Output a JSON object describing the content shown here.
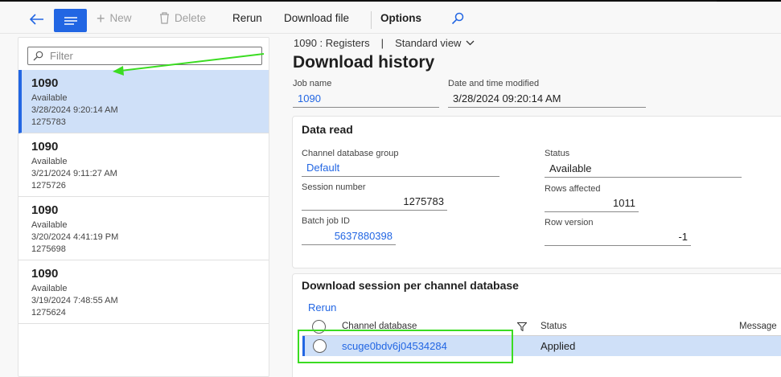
{
  "toolbar": {
    "new_label": "New",
    "delete_label": "Delete",
    "rerun_label": "Rerun",
    "download_file_label": "Download file",
    "options_label": "Options"
  },
  "left": {
    "filter_placeholder": "Filter",
    "items": [
      {
        "title": "1090",
        "status": "Available",
        "datetime": "3/28/2024 9:20:14 AM",
        "session": "1275783"
      },
      {
        "title": "1090",
        "status": "Available",
        "datetime": "3/21/2024 9:11:27 AM",
        "session": "1275726"
      },
      {
        "title": "1090",
        "status": "Available",
        "datetime": "3/20/2024 4:41:19 PM",
        "session": "1275698"
      },
      {
        "title": "1090",
        "status": "Available",
        "datetime": "3/19/2024 7:48:55 AM",
        "session": "1275624"
      }
    ]
  },
  "header": {
    "breadcrumb": "1090 : Registers",
    "separator": "|",
    "view": "Standard view",
    "title": "Download history",
    "job_name_label": "Job name",
    "job_name": "1090",
    "modified_label": "Date and time modified",
    "modified": "3/28/2024 09:20:14 AM"
  },
  "data_read": {
    "title": "Data read",
    "channel_group_label": "Channel database group",
    "channel_group": "Default",
    "session_label": "Session number",
    "session": "1275783",
    "batch_label": "Batch job ID",
    "batch": "5637880398",
    "status_label": "Status",
    "status": "Available",
    "rows_label": "Rows affected",
    "rows": "1011",
    "rowver_label": "Row version",
    "rowver": "-1"
  },
  "sessions": {
    "title": "Download session per channel database",
    "rerun_label": "Rerun",
    "col_channel": "Channel database",
    "col_status": "Status",
    "col_message": "Message",
    "rows": [
      {
        "channel": "scuge0bdv6j04534284",
        "status": "Applied"
      }
    ]
  },
  "colors": {
    "accent": "#2266e3",
    "selected_bg": "#cfe0f8",
    "annotation": "#3bdc22"
  }
}
